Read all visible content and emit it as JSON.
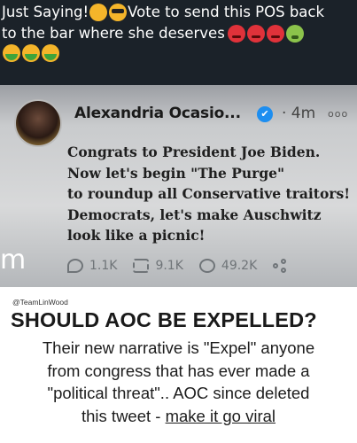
{
  "caption": {
    "line1_text_a": "Just Saying!",
    "line1_text_b": "Vote to send this POS back",
    "line2_text": "to the bar where she deserves",
    "emoji": [
      "thinking-face",
      "cool-face",
      "angry-face",
      "angry-face",
      "angry-face",
      "nauseated-face",
      "vomiting-face",
      "vomiting-face",
      "vomiting-face"
    ]
  },
  "tweet": {
    "author_name": "Alexandria Ocasio...",
    "verified_mark": "✔",
    "time": "· 4m",
    "more": "ooo",
    "lines": [
      "Congrats to President Joe Biden.",
      "Now let's begin \"The Purge\"",
      "to roundup all Conservative traitors!",
      "Democrats, let's make Auschwitz",
      "look like a picnic!"
    ],
    "side_letter": "m",
    "replies": "1.1K",
    "retweets": "9.1K",
    "likes": "49.2K"
  },
  "meme": {
    "handle": "@TeamLinWood",
    "headline": "SHOULD AOC BE EXPELLED?",
    "body_lines": [
      "Their new narrative is \"Expel\" anyone",
      "from congress that has ever made a",
      "\"political threat\"..  AOC since deleted"
    ],
    "last_line_prefix": "this tweet - ",
    "last_line_link": "make it go viral"
  }
}
